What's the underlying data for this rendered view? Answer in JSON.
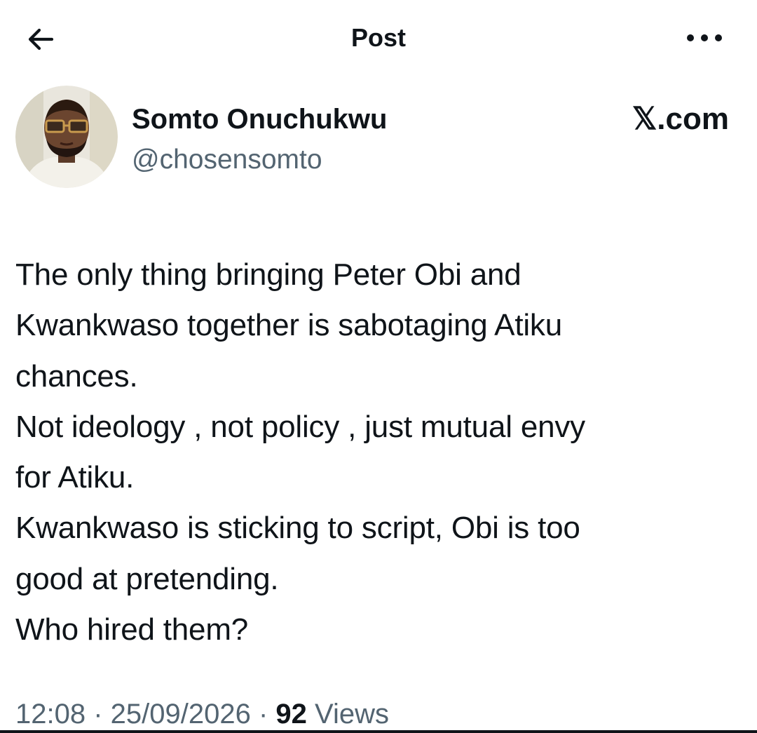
{
  "header": {
    "title": "Post",
    "back_icon": "arrow-left-icon",
    "more_icon": "more-horizontal-icon"
  },
  "author": {
    "name": "Somto Onuchukwu",
    "handle": "@chosensomto"
  },
  "brand": {
    "label": "𝕏.com"
  },
  "post": {
    "lines": [
      "The only thing bringing Peter Obi and",
      "Kwankwaso together is sabotaging Atiku",
      "chances.",
      "Not ideology , not policy , just mutual envy",
      "for Atiku.",
      "Kwankwaso is sticking to script, Obi is too",
      "good at pretending.",
      "Who hired them?"
    ]
  },
  "meta": {
    "time": "12:08",
    "separator": " · ",
    "date": "25/09/2026",
    "views_count": "92",
    "views_label": " Views"
  },
  "colors": {
    "text": "#0f1419",
    "secondary": "#536471",
    "background": "#ffffff"
  }
}
